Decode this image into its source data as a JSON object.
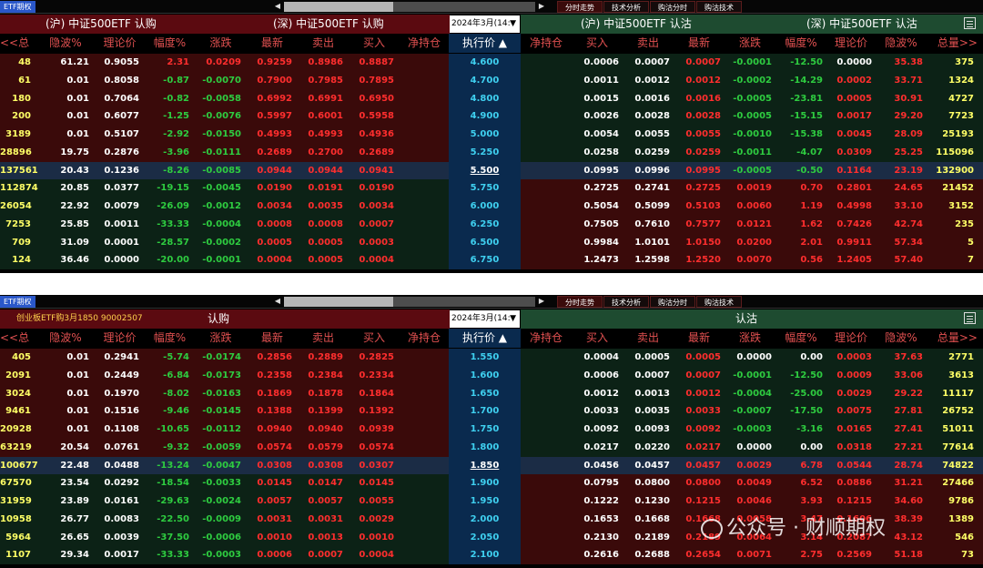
{
  "panels": [
    {
      "tag": "ETF期权",
      "tabs": [
        "分时走势",
        "技术分析",
        "购沽分时",
        "购沽技术"
      ],
      "left_title_a": "(沪) 中证500ETF 认购",
      "left_title_b": "(深) 中证500ETF 认购",
      "right_title_a": "(沪) 中证500ETF 认沽",
      "right_title_b": "(深) 中证500ETF 认沽",
      "date": "2024年3月(14:",
      "columns_left": [
        "<<总量",
        "隐波%",
        "理论价",
        "幅度%",
        "涨跌",
        "最新",
        "卖出",
        "买入",
        "净持仓"
      ],
      "strike_col": "执行价 ▲",
      "columns_right": [
        "净持仓",
        "买入",
        "卖出",
        "最新",
        "涨跌",
        "幅度%",
        "理论价",
        "隐波%",
        "总量>>"
      ],
      "atm_index": 6,
      "rows": [
        {
          "l": [
            "48",
            "61.21",
            "0.9055",
            "2.31",
            "0.0209",
            "0.9259",
            "0.8986",
            "0.8887",
            ""
          ],
          "k": "4.600",
          "r": [
            "",
            "0.0006",
            "0.0007",
            "0.0007",
            "-0.0001",
            "-12.50",
            "0.0000",
            "35.38",
            "375"
          ]
        },
        {
          "l": [
            "61",
            "0.01",
            "0.8058",
            "-0.87",
            "-0.0070",
            "0.7900",
            "0.7985",
            "0.7895",
            ""
          ],
          "k": "4.700",
          "r": [
            "",
            "0.0011",
            "0.0012",
            "0.0012",
            "-0.0002",
            "-14.29",
            "0.0002",
            "33.71",
            "1324"
          ]
        },
        {
          "l": [
            "180",
            "0.01",
            "0.7064",
            "-0.82",
            "-0.0058",
            "0.6992",
            "0.6991",
            "0.6950",
            ""
          ],
          "k": "4.800",
          "r": [
            "",
            "0.0015",
            "0.0016",
            "0.0016",
            "-0.0005",
            "-23.81",
            "0.0005",
            "30.91",
            "4727"
          ]
        },
        {
          "l": [
            "200",
            "0.01",
            "0.6077",
            "-1.25",
            "-0.0076",
            "0.5997",
            "0.6001",
            "0.5958",
            ""
          ],
          "k": "4.900",
          "r": [
            "",
            "0.0026",
            "0.0028",
            "0.0028",
            "-0.0005",
            "-15.15",
            "0.0017",
            "29.20",
            "7723"
          ]
        },
        {
          "l": [
            "3189",
            "0.01",
            "0.5107",
            "-2.92",
            "-0.0150",
            "0.4993",
            "0.4993",
            "0.4936",
            ""
          ],
          "k": "5.000",
          "r": [
            "",
            "0.0054",
            "0.0055",
            "0.0055",
            "-0.0010",
            "-15.38",
            "0.0045",
            "28.09",
            "25193"
          ]
        },
        {
          "l": [
            "28896",
            "19.75",
            "0.2876",
            "-3.96",
            "-0.0111",
            "0.2689",
            "0.2700",
            "0.2689",
            ""
          ],
          "k": "5.250",
          "r": [
            "",
            "0.0258",
            "0.0259",
            "0.0259",
            "-0.0011",
            "-4.07",
            "0.0309",
            "25.25",
            "115096"
          ]
        },
        {
          "l": [
            "137561",
            "20.43",
            "0.1236",
            "-8.26",
            "-0.0085",
            "0.0944",
            "0.0944",
            "0.0941",
            ""
          ],
          "k": "5.500",
          "r": [
            "",
            "0.0995",
            "0.0996",
            "0.0995",
            "-0.0005",
            "-0.50",
            "0.1164",
            "23.19",
            "132900"
          ]
        },
        {
          "l": [
            "112874",
            "20.85",
            "0.0377",
            "-19.15",
            "-0.0045",
            "0.0190",
            "0.0191",
            "0.0190",
            ""
          ],
          "k": "5.750",
          "r": [
            "",
            "0.2725",
            "0.2741",
            "0.2725",
            "0.0019",
            "0.70",
            "0.2801",
            "24.65",
            "21452"
          ]
        },
        {
          "l": [
            "26054",
            "22.92",
            "0.0079",
            "-26.09",
            "-0.0012",
            "0.0034",
            "0.0035",
            "0.0034",
            ""
          ],
          "k": "6.000",
          "r": [
            "",
            "0.5054",
            "0.5099",
            "0.5103",
            "0.0060",
            "1.19",
            "0.4998",
            "33.10",
            "3152"
          ]
        },
        {
          "l": [
            "7253",
            "25.85",
            "0.0011",
            "-33.33",
            "-0.0004",
            "0.0008",
            "0.0008",
            "0.0007",
            ""
          ],
          "k": "6.250",
          "r": [
            "",
            "0.7505",
            "0.7610",
            "0.7577",
            "0.0121",
            "1.62",
            "0.7426",
            "42.74",
            "235"
          ]
        },
        {
          "l": [
            "709",
            "31.09",
            "0.0001",
            "-28.57",
            "-0.0002",
            "0.0005",
            "0.0005",
            "0.0003",
            ""
          ],
          "k": "6.500",
          "r": [
            "",
            "0.9984",
            "1.0101",
            "1.0150",
            "0.0200",
            "2.01",
            "0.9911",
            "57.34",
            "5"
          ]
        },
        {
          "l": [
            "124",
            "36.46",
            "0.0000",
            "-20.00",
            "-0.0001",
            "0.0004",
            "0.0005",
            "0.0004",
            ""
          ],
          "k": "6.750",
          "r": [
            "",
            "1.2473",
            "1.2598",
            "1.2520",
            "0.0070",
            "0.56",
            "1.2405",
            "57.40",
            "7"
          ]
        }
      ]
    },
    {
      "tag": "ETF期权",
      "tabs": [
        "分时走势",
        "技术分析",
        "购沽分时",
        "购沽技术"
      ],
      "left_title_a": "创业板ETF购3月1850 90002507",
      "left_title_b": "认购",
      "right_title_a": "",
      "right_title_b": "认沽",
      "date": "2024年3月(14:",
      "columns_left": [
        "<<总量",
        "隐波%",
        "理论价",
        "幅度%",
        "涨跌",
        "最新",
        "卖出",
        "买入",
        "净持仓"
      ],
      "strike_col": "执行价 ▲",
      "columns_right": [
        "净持仓",
        "买入",
        "卖出",
        "最新",
        "涨跌",
        "幅度%",
        "理论价",
        "隐波%",
        "总量>>"
      ],
      "atm_index": 6,
      "rows": [
        {
          "l": [
            "405",
            "0.01",
            "0.2941",
            "-5.74",
            "-0.0174",
            "0.2856",
            "0.2889",
            "0.2825",
            ""
          ],
          "k": "1.550",
          "r": [
            "",
            "0.0004",
            "0.0005",
            "0.0005",
            "0.0000",
            "0.00",
            "0.0003",
            "37.63",
            "2771"
          ]
        },
        {
          "l": [
            "2091",
            "0.01",
            "0.2449",
            "-6.84",
            "-0.0173",
            "0.2358",
            "0.2384",
            "0.2334",
            ""
          ],
          "k": "1.600",
          "r": [
            "",
            "0.0006",
            "0.0007",
            "0.0007",
            "-0.0001",
            "-12.50",
            "0.0009",
            "33.06",
            "3613"
          ]
        },
        {
          "l": [
            "3024",
            "0.01",
            "0.1970",
            "-8.02",
            "-0.0163",
            "0.1869",
            "0.1878",
            "0.1864",
            ""
          ],
          "k": "1.650",
          "r": [
            "",
            "0.0012",
            "0.0013",
            "0.0012",
            "-0.0004",
            "-25.00",
            "0.0029",
            "29.22",
            "11117"
          ]
        },
        {
          "l": [
            "9461",
            "0.01",
            "0.1516",
            "-9.46",
            "-0.0145",
            "0.1388",
            "0.1399",
            "0.1392",
            ""
          ],
          "k": "1.700",
          "r": [
            "",
            "0.0033",
            "0.0035",
            "0.0033",
            "-0.0007",
            "-17.50",
            "0.0075",
            "27.81",
            "26752"
          ]
        },
        {
          "l": [
            "20928",
            "0.01",
            "0.1108",
            "-10.65",
            "-0.0112",
            "0.0940",
            "0.0940",
            "0.0939",
            ""
          ],
          "k": "1.750",
          "r": [
            "",
            "0.0092",
            "0.0093",
            "0.0092",
            "-0.0003",
            "-3.16",
            "0.0165",
            "27.41",
            "51011"
          ]
        },
        {
          "l": [
            "63219",
            "20.54",
            "0.0761",
            "-9.32",
            "-0.0059",
            "0.0574",
            "0.0579",
            "0.0574",
            ""
          ],
          "k": "1.800",
          "r": [
            "",
            "0.0217",
            "0.0220",
            "0.0217",
            "0.0000",
            "0.00",
            "0.0318",
            "27.21",
            "77614"
          ]
        },
        {
          "l": [
            "100677",
            "22.48",
            "0.0488",
            "-13.24",
            "-0.0047",
            "0.0308",
            "0.0308",
            "0.0307",
            ""
          ],
          "k": "1.850",
          "r": [
            "",
            "0.0456",
            "0.0457",
            "0.0457",
            "0.0029",
            "6.78",
            "0.0544",
            "28.74",
            "74822"
          ]
        },
        {
          "l": [
            "67570",
            "23.54",
            "0.0292",
            "-18.54",
            "-0.0033",
            "0.0145",
            "0.0147",
            "0.0145",
            ""
          ],
          "k": "1.900",
          "r": [
            "",
            "0.0795",
            "0.0800",
            "0.0800",
            "0.0049",
            "6.52",
            "0.0886",
            "31.21",
            "27466"
          ]
        },
        {
          "l": [
            "31959",
            "23.89",
            "0.0161",
            "-29.63",
            "-0.0024",
            "0.0057",
            "0.0057",
            "0.0055",
            ""
          ],
          "k": "1.950",
          "r": [
            "",
            "0.1222",
            "0.1230",
            "0.1215",
            "0.0046",
            "3.93",
            "0.1215",
            "34.60",
            "9786"
          ]
        },
        {
          "l": [
            "10958",
            "26.77",
            "0.0083",
            "-22.50",
            "-0.0009",
            "0.0031",
            "0.0031",
            "0.0029",
            ""
          ],
          "k": "2.000",
          "r": [
            "",
            "0.1653",
            "0.1668",
            "0.1668",
            "0.0058",
            "3.47",
            "0.1606",
            "38.39",
            "1389"
          ]
        },
        {
          "l": [
            "5964",
            "26.65",
            "0.0039",
            "-37.50",
            "-0.0006",
            "0.0010",
            "0.0013",
            "0.0010",
            ""
          ],
          "k": "2.050",
          "r": [
            "",
            "0.2130",
            "0.2189",
            "0.2189",
            "0.0064",
            "3.14",
            "0.2087",
            "43.12",
            "546"
          ]
        },
        {
          "l": [
            "1107",
            "29.34",
            "0.0017",
            "-33.33",
            "-0.0003",
            "0.0006",
            "0.0007",
            "0.0004",
            ""
          ],
          "k": "2.100",
          "r": [
            "",
            "0.2616",
            "0.2688",
            "0.2654",
            "0.0071",
            "2.75",
            "0.2569",
            "51.18",
            "73"
          ]
        }
      ]
    }
  ],
  "watermark": "公众号 · 财顺期权",
  "colors": {
    "call_bg": "#5b0a10",
    "put_bg": "#1e4b30",
    "itm_call": "#4a0a0a",
    "itm_put": "#0c2a1a",
    "strike_bg": "#0a2a4e",
    "up": "#ff2e2e",
    "down": "#2ecc40",
    "text_yellow": "#ffff66"
  }
}
